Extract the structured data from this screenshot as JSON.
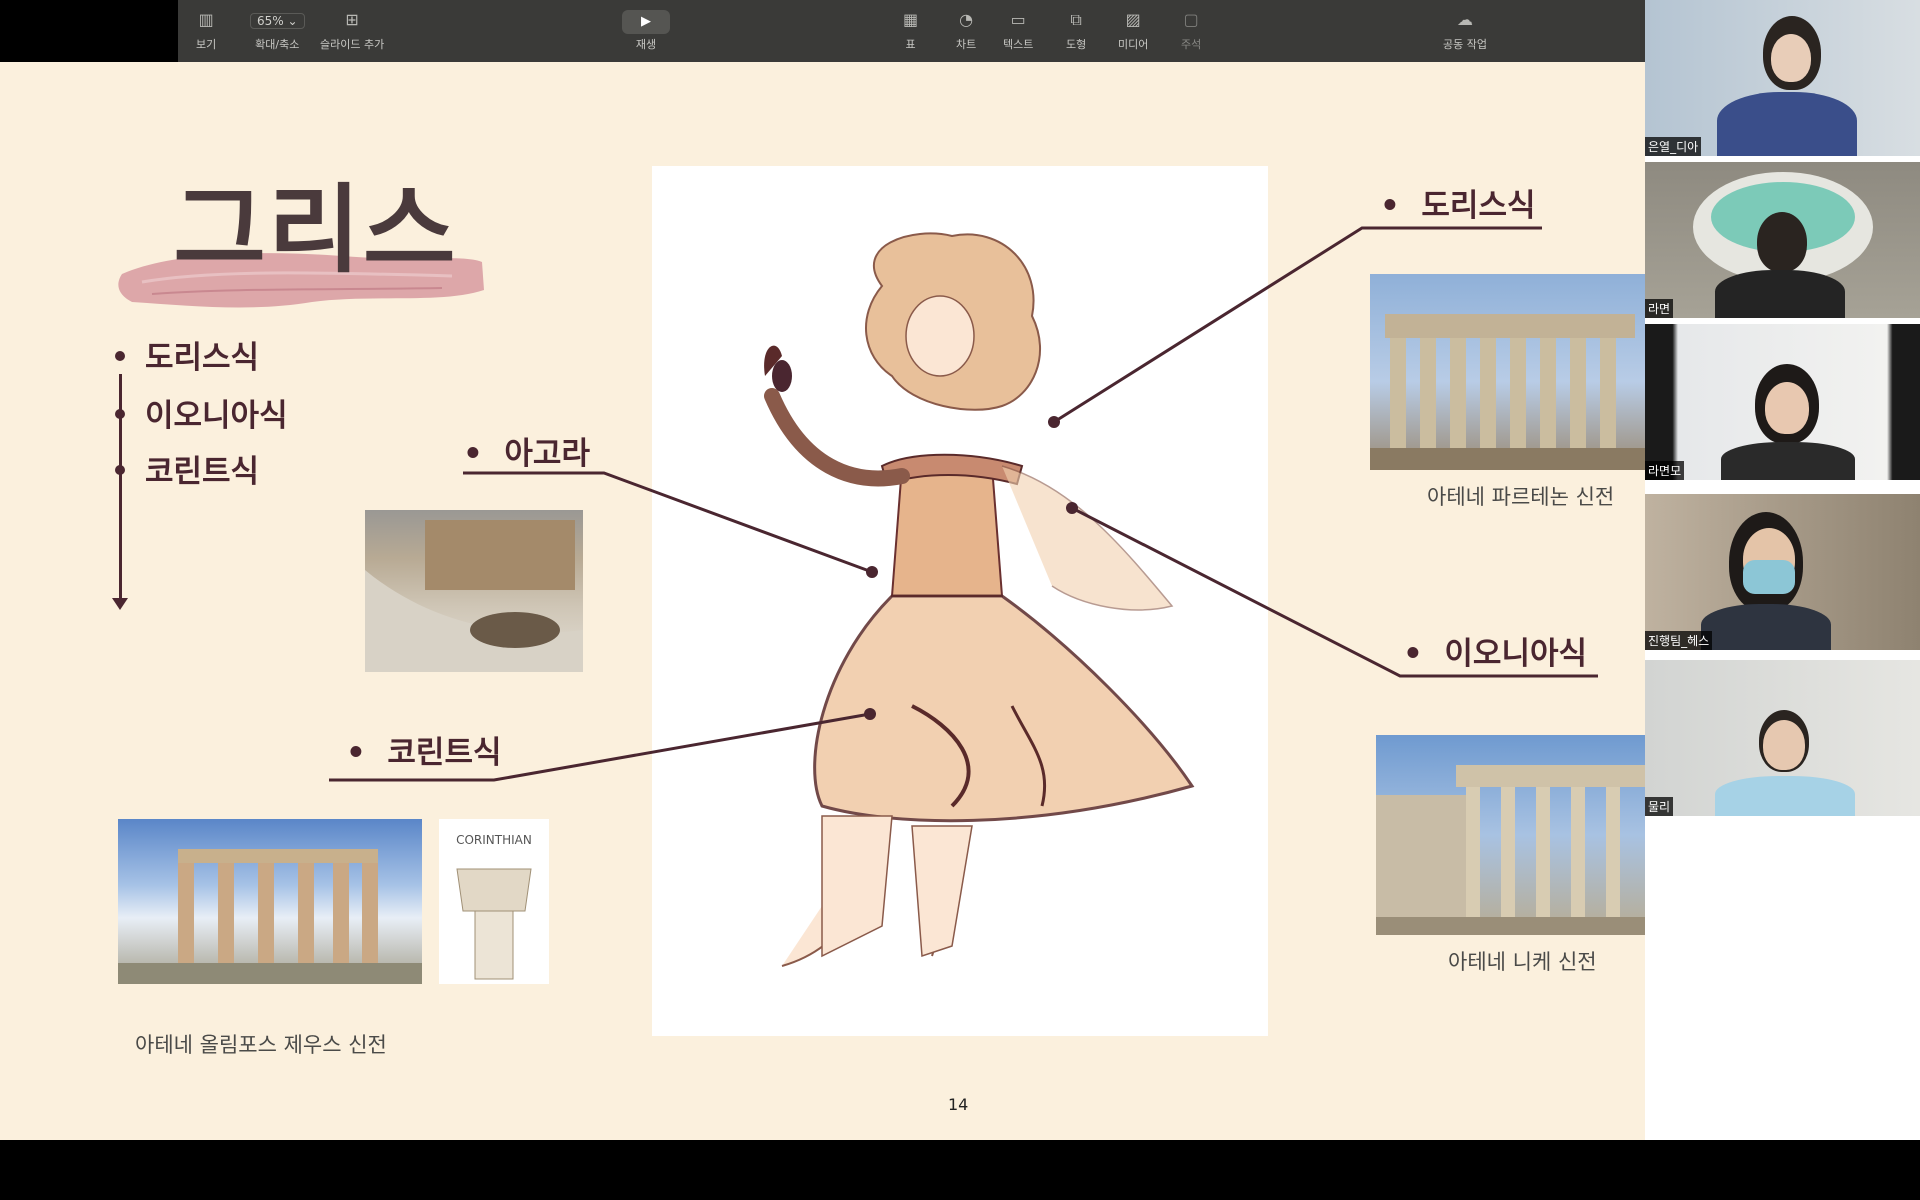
{
  "toolbar": {
    "items": [
      {
        "label": "보기",
        "icon": "sidebar-icon"
      },
      {
        "label": "확대/축소",
        "value": "65%",
        "icon": "zoom-icon"
      },
      {
        "label": "슬라이드 추가",
        "icon": "add-slide-icon"
      },
      {
        "label": "재생",
        "icon": "play-icon"
      },
      {
        "label": "표",
        "icon": "table-icon"
      },
      {
        "label": "차트",
        "icon": "chart-icon"
      },
      {
        "label": "텍스트",
        "icon": "text-icon"
      },
      {
        "label": "도형",
        "icon": "shape-icon"
      },
      {
        "label": "미디어",
        "icon": "media-icon"
      },
      {
        "label": "주석",
        "icon": "comment-icon"
      },
      {
        "label": "공동 작업",
        "icon": "collaborate-icon"
      }
    ]
  },
  "slide": {
    "title": "그리스",
    "order_list": [
      "도리스식",
      "이오니아식",
      "코린트식"
    ],
    "labels": {
      "doric": "도리스식",
      "agora": "아고라",
      "ionic": "이오니아식",
      "corinthian": "코린트식"
    },
    "captions": {
      "parthenon": "아테네 파르테논 신전",
      "nike": "아테네 니케 신전",
      "zeus": "아테네 올림포스 제우스 신전"
    },
    "corinthian_card_text": "CORINTHIAN",
    "page_number": "14"
  },
  "participants": [
    {
      "name": "은열_디아"
    },
    {
      "name": "라면"
    },
    {
      "name": "라면모"
    },
    {
      "name": "진행팀_헤스"
    },
    {
      "name": "물리"
    }
  ],
  "colors": {
    "slide_bg": "#fbf0dd",
    "accent": "#4a2630",
    "brush": "#d79aa0",
    "toolbar": "#3a3a38"
  }
}
